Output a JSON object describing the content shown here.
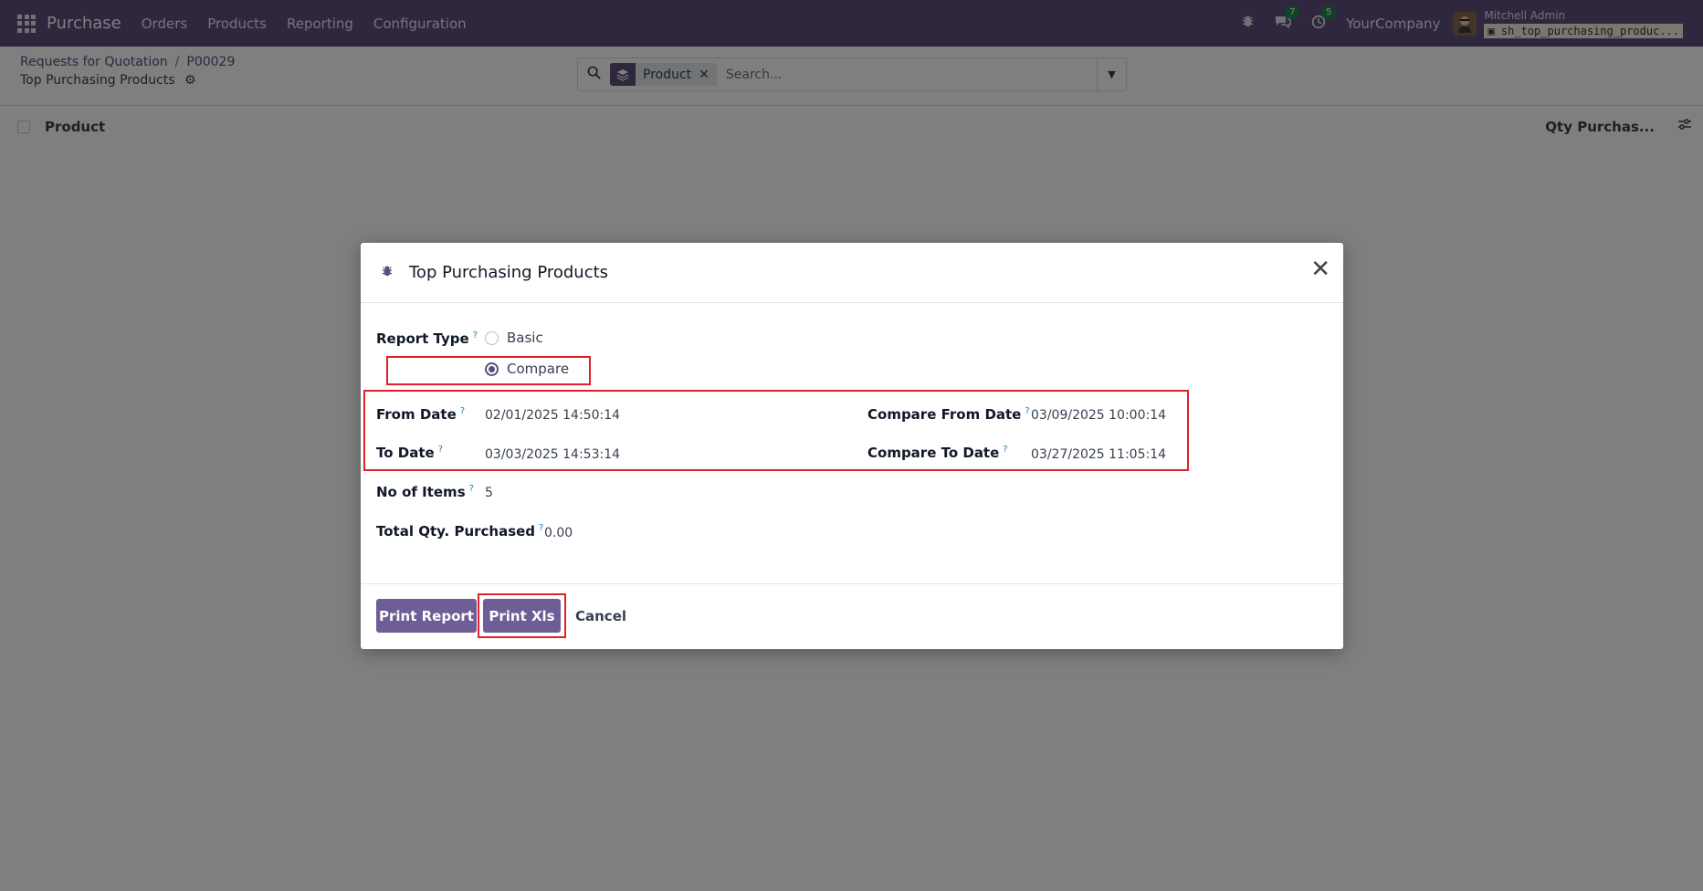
{
  "navbar": {
    "app_name": "Purchase",
    "menu": [
      "Orders",
      "Products",
      "Reporting",
      "Configuration"
    ],
    "chat_count": "7",
    "activity_count": "5",
    "company": "YourCompany",
    "user_name": "Mitchell Admin",
    "database": "sh_top_purchasing_produc..."
  },
  "control_panel": {
    "breadcrumb": [
      "Requests for Quotation",
      "P00029"
    ],
    "title": "Top Purchasing Products",
    "search": {
      "facet_label": "Product",
      "placeholder": "Search..."
    }
  },
  "list": {
    "columns": [
      "Product",
      "Qty Purchas..."
    ]
  },
  "dialog": {
    "title": "Top Purchasing Products",
    "report_type": {
      "label": "Report Type",
      "options": [
        "Basic",
        "Compare"
      ],
      "selected": "Compare"
    },
    "fields": {
      "from_date": {
        "label": "From Date",
        "value": "02/01/2025 14:50:14"
      },
      "to_date": {
        "label": "To Date",
        "value": "03/03/2025 14:53:14"
      },
      "compare_from_date": {
        "label": "Compare From Date",
        "value": "03/09/2025 10:00:14"
      },
      "compare_to_date": {
        "label": "Compare To Date",
        "value": "03/27/2025 11:05:14"
      },
      "no_of_items": {
        "label": "No of Items",
        "value": "5"
      },
      "total_qty": {
        "label": "Total Qty. Purchased",
        "value": "0.00"
      }
    },
    "help_marker": "?",
    "buttons": {
      "print_report": "Print Report",
      "print_xls": "Print Xls",
      "cancel": "Cancel"
    }
  },
  "colors": {
    "brand": "#5d4e7d",
    "primary_button": "#6f5d95",
    "highlight": "#e0202a",
    "badge": "#1f8a4c"
  }
}
